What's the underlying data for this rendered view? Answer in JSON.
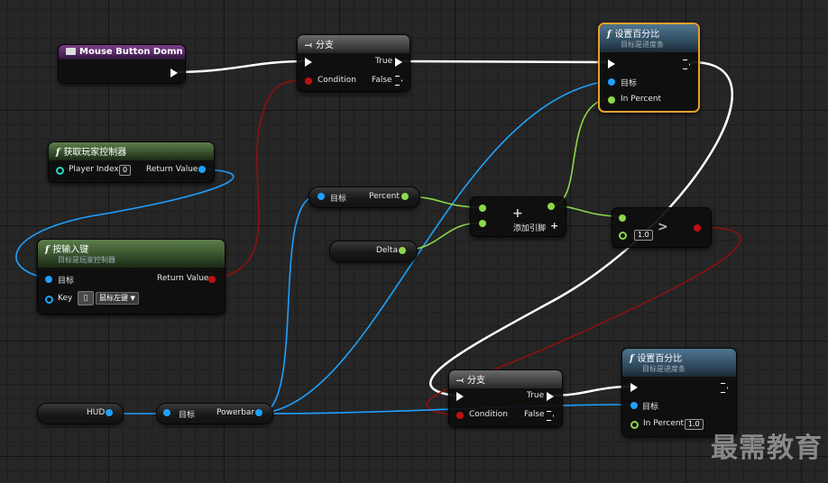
{
  "nodes": {
    "mouse_event": {
      "title": "Mouse Button Domn"
    },
    "branch1": {
      "title": "分支",
      "condition": "Condition",
      "true_label": "True",
      "false_label": "False"
    },
    "set_percent1": {
      "title": "设置百分比",
      "subtitle": "目标是进度条",
      "target": "目标",
      "in_percent": "In Percent"
    },
    "get_player_controller": {
      "title": "获取玩家控制器",
      "player_index": "Player Index",
      "player_index_value": "0",
      "return_value": "Return Value"
    },
    "input_key": {
      "title": "按输入键",
      "subtitle": "目标是玩家控制器",
      "target": "目标",
      "return_value": "Return Value",
      "key": "Key",
      "key_value": "鼠标左键"
    },
    "get_percent": {
      "target": "目标",
      "percent": "Percent"
    },
    "delta": {
      "label": "Delta"
    },
    "add": {
      "symbol": "+",
      "add_pin": "添加引脚"
    },
    "greater": {
      "value": "1.0",
      "symbol": ">"
    },
    "hud": {
      "label": "HUD"
    },
    "powerbar": {
      "target": "目标",
      "label": "Powerbar"
    },
    "branch2": {
      "title": "分支",
      "condition": "Condition",
      "true_label": "True",
      "false_label": "False"
    },
    "set_percent2": {
      "title": "设置百分比",
      "subtitle": "目标是进度条",
      "target": "目标",
      "in_percent": "In Percent",
      "in_percent_value": "1.0"
    }
  },
  "watermark": "最需教育",
  "colors": {
    "exec": "#ffffff",
    "object": "#1ea0ff",
    "float": "#8cd84a",
    "bool": "#a01010",
    "selected": "#e8a22a"
  }
}
